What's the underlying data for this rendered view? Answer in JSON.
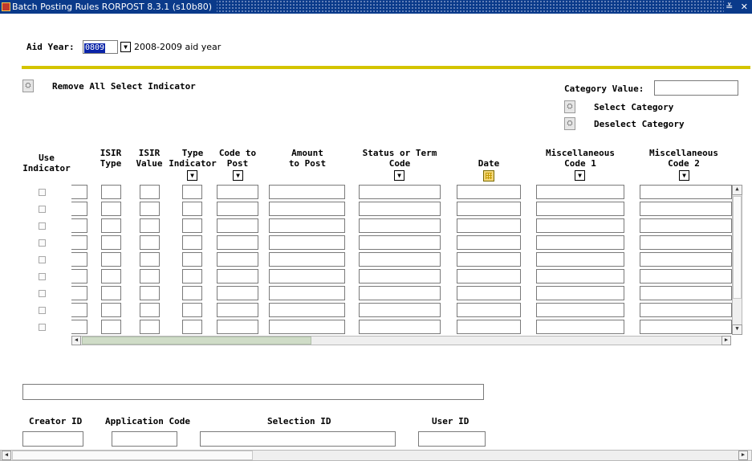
{
  "window": {
    "title": "Batch Posting Rules  RORPOST  8.3.1  (s10b80)",
    "controls": "≚ ✕"
  },
  "key_block": {
    "aid_year_label": "Aid Year:",
    "aid_year_value": "0809",
    "aid_year_description": "2008-2009 aid year"
  },
  "actions": {
    "remove_all_label": "Remove All Select Indicator",
    "category_value_label": "Category Value:",
    "category_value": "",
    "select_category_label": "Select Category",
    "deselect_category_label": "Deselect Category"
  },
  "grid": {
    "headers": {
      "use_indicator_1": "Use",
      "use_indicator_2": "Indicator",
      "isir_type_1": "ISIR",
      "isir_type_2": "Type",
      "isir_value_1": "ISIR",
      "isir_value_2": "Value",
      "type_indicator_1": "Type",
      "type_indicator_2": "Indicator",
      "code_to_post_1": "Code to",
      "code_to_post_2": "Post",
      "amount_1": "Amount",
      "amount_2": "to Post",
      "status_1": "Status or Term",
      "status_2": "Code",
      "date": "Date",
      "misc1_1": "Miscellaneous",
      "misc1_2": "Code 1",
      "misc2_1": "Miscellaneous",
      "misc2_2": "Code 2"
    },
    "row_count": 9
  },
  "bottom": {
    "message": "",
    "creator_id_label": "Creator ID",
    "application_code_label": "Application Code",
    "selection_id_label": "Selection ID",
    "user_id_label": "User ID",
    "creator_id": "",
    "application_code": "",
    "selection_id": "",
    "user_id": ""
  },
  "colors": {
    "title_bar": "#0a3a8a",
    "separator": "#d4c400",
    "aid_year_highlight": "#0a24a8"
  }
}
